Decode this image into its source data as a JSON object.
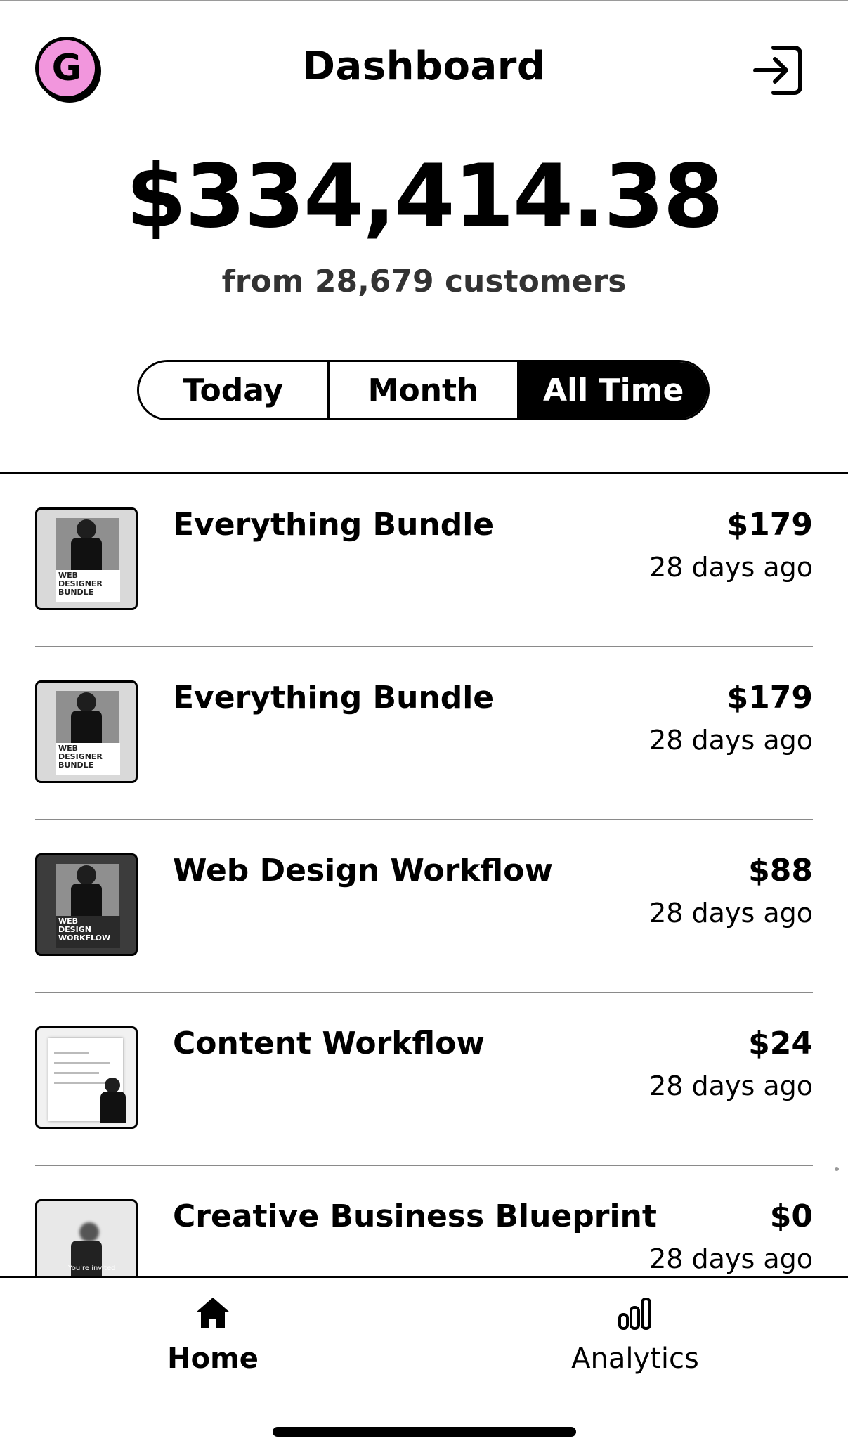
{
  "header": {
    "avatar_initial": "G",
    "title": "Dashboard",
    "logout_icon": "logout-icon"
  },
  "summary": {
    "total": "$334,414.38",
    "subtitle": "from 28,679 customers"
  },
  "range_tabs": {
    "items": [
      {
        "label": "Today",
        "active": false
      },
      {
        "label": "Month",
        "active": false
      },
      {
        "label": "All Time",
        "active": true
      }
    ]
  },
  "sales": [
    {
      "name": "Everything Bundle",
      "price": "$179",
      "ago": "28 days ago",
      "thumb_text": "WEB DESIGNER BUNDLE"
    },
    {
      "name": "Everything Bundle",
      "price": "$179",
      "ago": "28 days ago",
      "thumb_text": "WEB DESIGNER BUNDLE"
    },
    {
      "name": "Web Design Workflow",
      "price": "$88",
      "ago": "28 days ago",
      "thumb_text": "WEB DESIGN WORKFLOW"
    },
    {
      "name": "Content Workflow",
      "price": "$24",
      "ago": "28 days ago",
      "thumb_text": ""
    },
    {
      "name": "Creative Business Blueprint",
      "price": "$0",
      "ago": "28 days ago",
      "thumb_text": "You're invited"
    }
  ],
  "bottom_nav": {
    "home_label": "Home",
    "analytics_label": "Analytics"
  },
  "colors": {
    "avatar_bg": "#f296dd",
    "active_tab_bg": "#000000",
    "text": "#000000"
  }
}
